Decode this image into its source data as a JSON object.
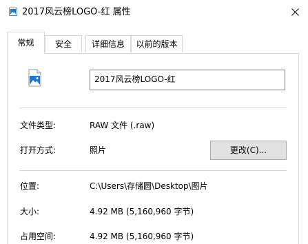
{
  "window": {
    "title": "2017风云榜LOGO-红 属性",
    "title_icon": "image-file-icon",
    "close_glyph": "X"
  },
  "tabs": [
    {
      "label": "常规",
      "active": true
    },
    {
      "label": "安全",
      "active": false
    },
    {
      "label": "详细信息",
      "active": false
    },
    {
      "label": "以前的版本",
      "active": false
    }
  ],
  "general": {
    "file_icon": "image-file-icon",
    "file_name": "2017风云榜LOGO-红",
    "file_type": {
      "label": "文件类型:",
      "value": "RAW 文件 (.raw)"
    },
    "opens_with": {
      "label": "打开方式:",
      "value": "照片",
      "button": "更改(C)..."
    },
    "location": {
      "label": "位置:",
      "value": "C:\\Users\\存储圆\\Desktop\\图片"
    },
    "size": {
      "label": "大小:",
      "value": "4.92 MB (5,160,960 字节)"
    },
    "size_on_disk": {
      "label": "占用空间:",
      "value": "4.92 MB (5,160,960 字节)"
    }
  },
  "colors": {
    "accent": "#1e78d7",
    "border": "#d9d9d9",
    "button_bg": "#e1e1e1"
  }
}
